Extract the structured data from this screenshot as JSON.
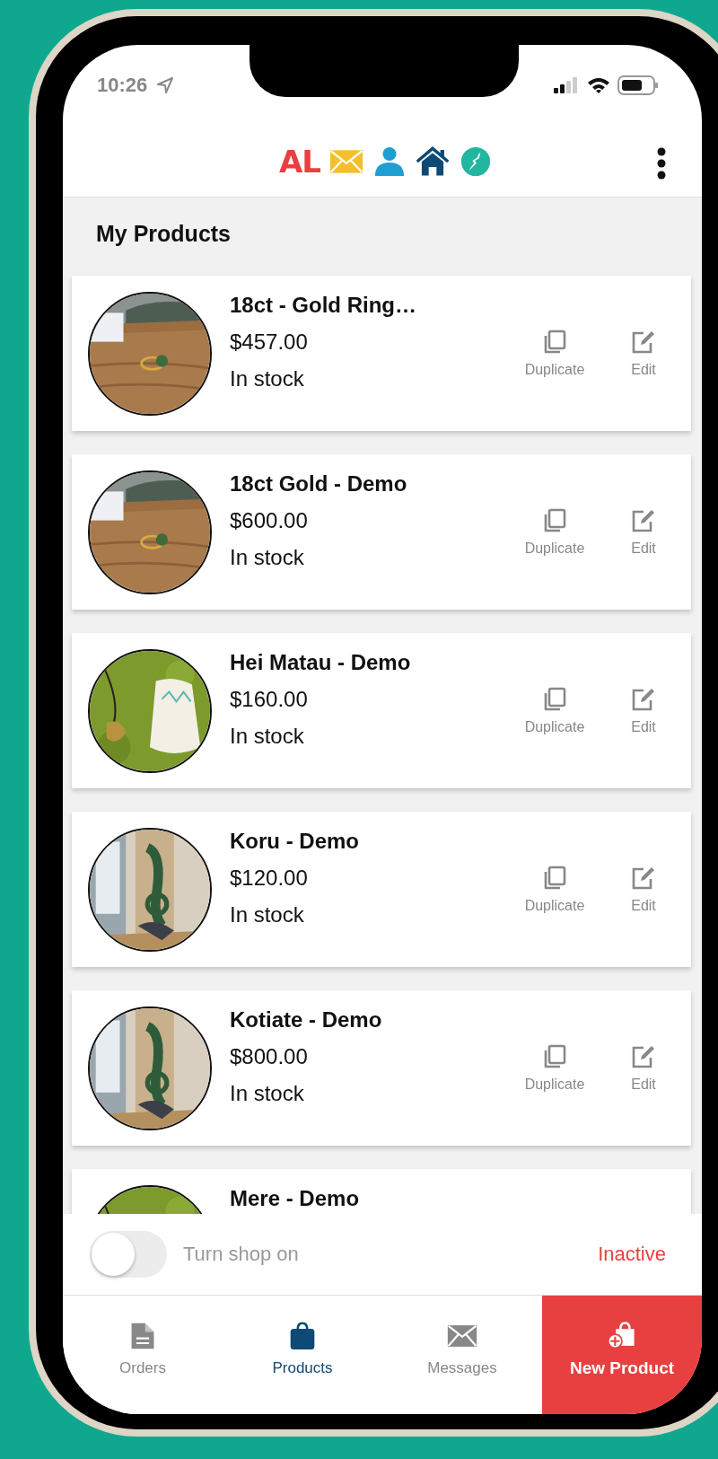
{
  "status_bar": {
    "time": "10:26"
  },
  "header": {
    "logo": "AL"
  },
  "page_title": "My Products",
  "products": [
    {
      "name": "18ct - Gold Ring…",
      "price": "$457.00",
      "stock": "In stock",
      "actions": [
        "Duplicate",
        "Edit"
      ]
    },
    {
      "name": "18ct Gold - Demo",
      "price": "$600.00",
      "stock": "In stock",
      "actions": [
        "Duplicate",
        "Edit"
      ]
    },
    {
      "name": "Hei Matau - Demo",
      "price": "$160.00",
      "stock": "In stock",
      "actions": [
        "Duplicate",
        "Edit"
      ]
    },
    {
      "name": "Koru - Demo",
      "price": "$120.00",
      "stock": "In stock",
      "actions": [
        "Duplicate",
        "Edit"
      ]
    },
    {
      "name": "Kotiate - Demo",
      "price": "$800.00",
      "stock": "In stock",
      "actions": [
        "Duplicate",
        "Edit"
      ]
    },
    {
      "name": "Mere - Demo"
    }
  ],
  "shop_toggle": {
    "label": "Turn shop on",
    "on": false,
    "status": "Inactive"
  },
  "bottom_nav": [
    {
      "label": "Orders",
      "kind": "tab",
      "selected": false
    },
    {
      "label": "Products",
      "kind": "tab",
      "selected": true
    },
    {
      "label": "Messages",
      "kind": "tab",
      "selected": false
    },
    {
      "label": "New Product",
      "kind": "action",
      "selected": false
    }
  ]
}
